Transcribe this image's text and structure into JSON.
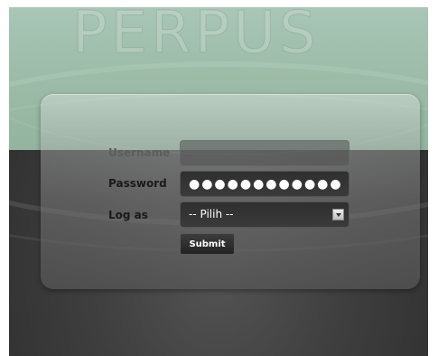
{
  "background": {
    "watermark_text": "PERPUS"
  },
  "login_form": {
    "username": {
      "label": "Username",
      "value": ""
    },
    "password": {
      "label": "Password",
      "masked_value": "●●●●●●●●●●●●"
    },
    "log_as": {
      "label": "Log as",
      "selected": "-- Pilih --"
    },
    "submit_label": "Submit"
  },
  "colors": {
    "top_band": "#a0bfad",
    "background_dark": "#3e3e3e",
    "field_bg": "#333333",
    "button_bg": "#2c2c2c"
  }
}
